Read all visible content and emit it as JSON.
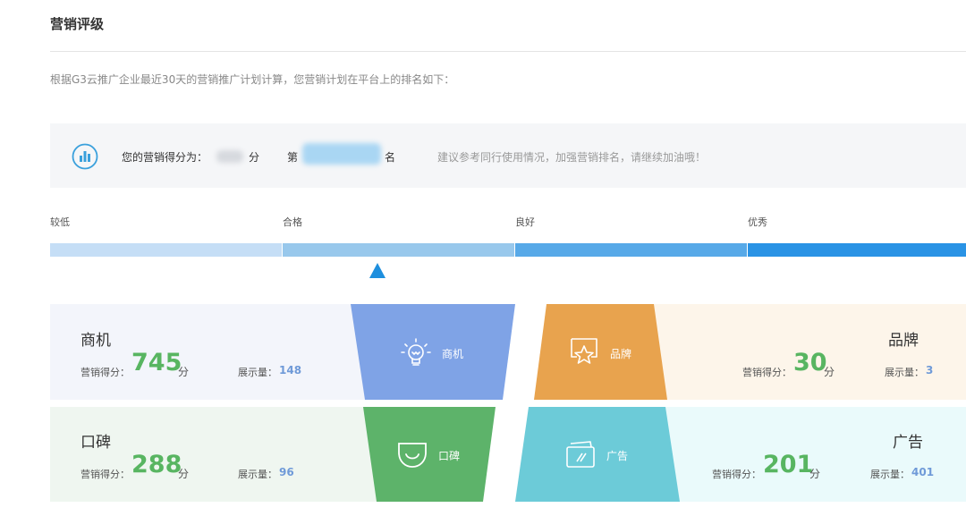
{
  "header": {
    "title": "营销评级"
  },
  "description": "根据G3云推广企业最近30天的营销推广计划计算，您营销计划在平台上的排名如下：",
  "score_panel": {
    "icon": "bar-chart-circle-icon",
    "score_prefix": "您的营销得分为：",
    "score_suffix": "分",
    "rank_prefix": "第",
    "rank_suffix": "名",
    "advice": "建议参考同行使用情况，加强营销排名，请继续加油哦！"
  },
  "levels": [
    {
      "label": "较低",
      "color": "#c5def6"
    },
    {
      "label": "合格",
      "color": "#98c8ec"
    },
    {
      "label": "良好",
      "color": "#57a9e8"
    },
    {
      "label": "优秀",
      "color": "#2a93e5"
    }
  ],
  "current_level": "合格",
  "cards": {
    "opportunity": {
      "name": "商机",
      "score_label": "营销得分：",
      "score": "745",
      "unit": "分",
      "impressions_label": "展示量：",
      "impressions": "148",
      "tab_label": "商机",
      "tab_icon": "lightbulb-icon",
      "color": "#7fa3e6"
    },
    "brand": {
      "name": "品牌",
      "score_label": "营销得分：",
      "score": "30",
      "unit": "分",
      "impressions_label": "展示量：",
      "impressions": "3",
      "tab_label": "品牌",
      "tab_icon": "star-badge-icon",
      "color": "#e8a34e"
    },
    "reputation": {
      "name": "口碑",
      "score_label": "营销得分：",
      "score": "288",
      "unit": "分",
      "impressions_label": "展示量：",
      "impressions": "96",
      "tab_label": "口碑",
      "tab_icon": "smile-shield-icon",
      "color": "#5db36a"
    },
    "ads": {
      "name": "广告",
      "score_label": "营销得分：",
      "score": "201",
      "unit": "分",
      "impressions_label": "展示量：",
      "impressions": "401",
      "tab_label": "广告",
      "tab_icon": "ad-cards-icon",
      "color": "#6ccbd8"
    }
  }
}
